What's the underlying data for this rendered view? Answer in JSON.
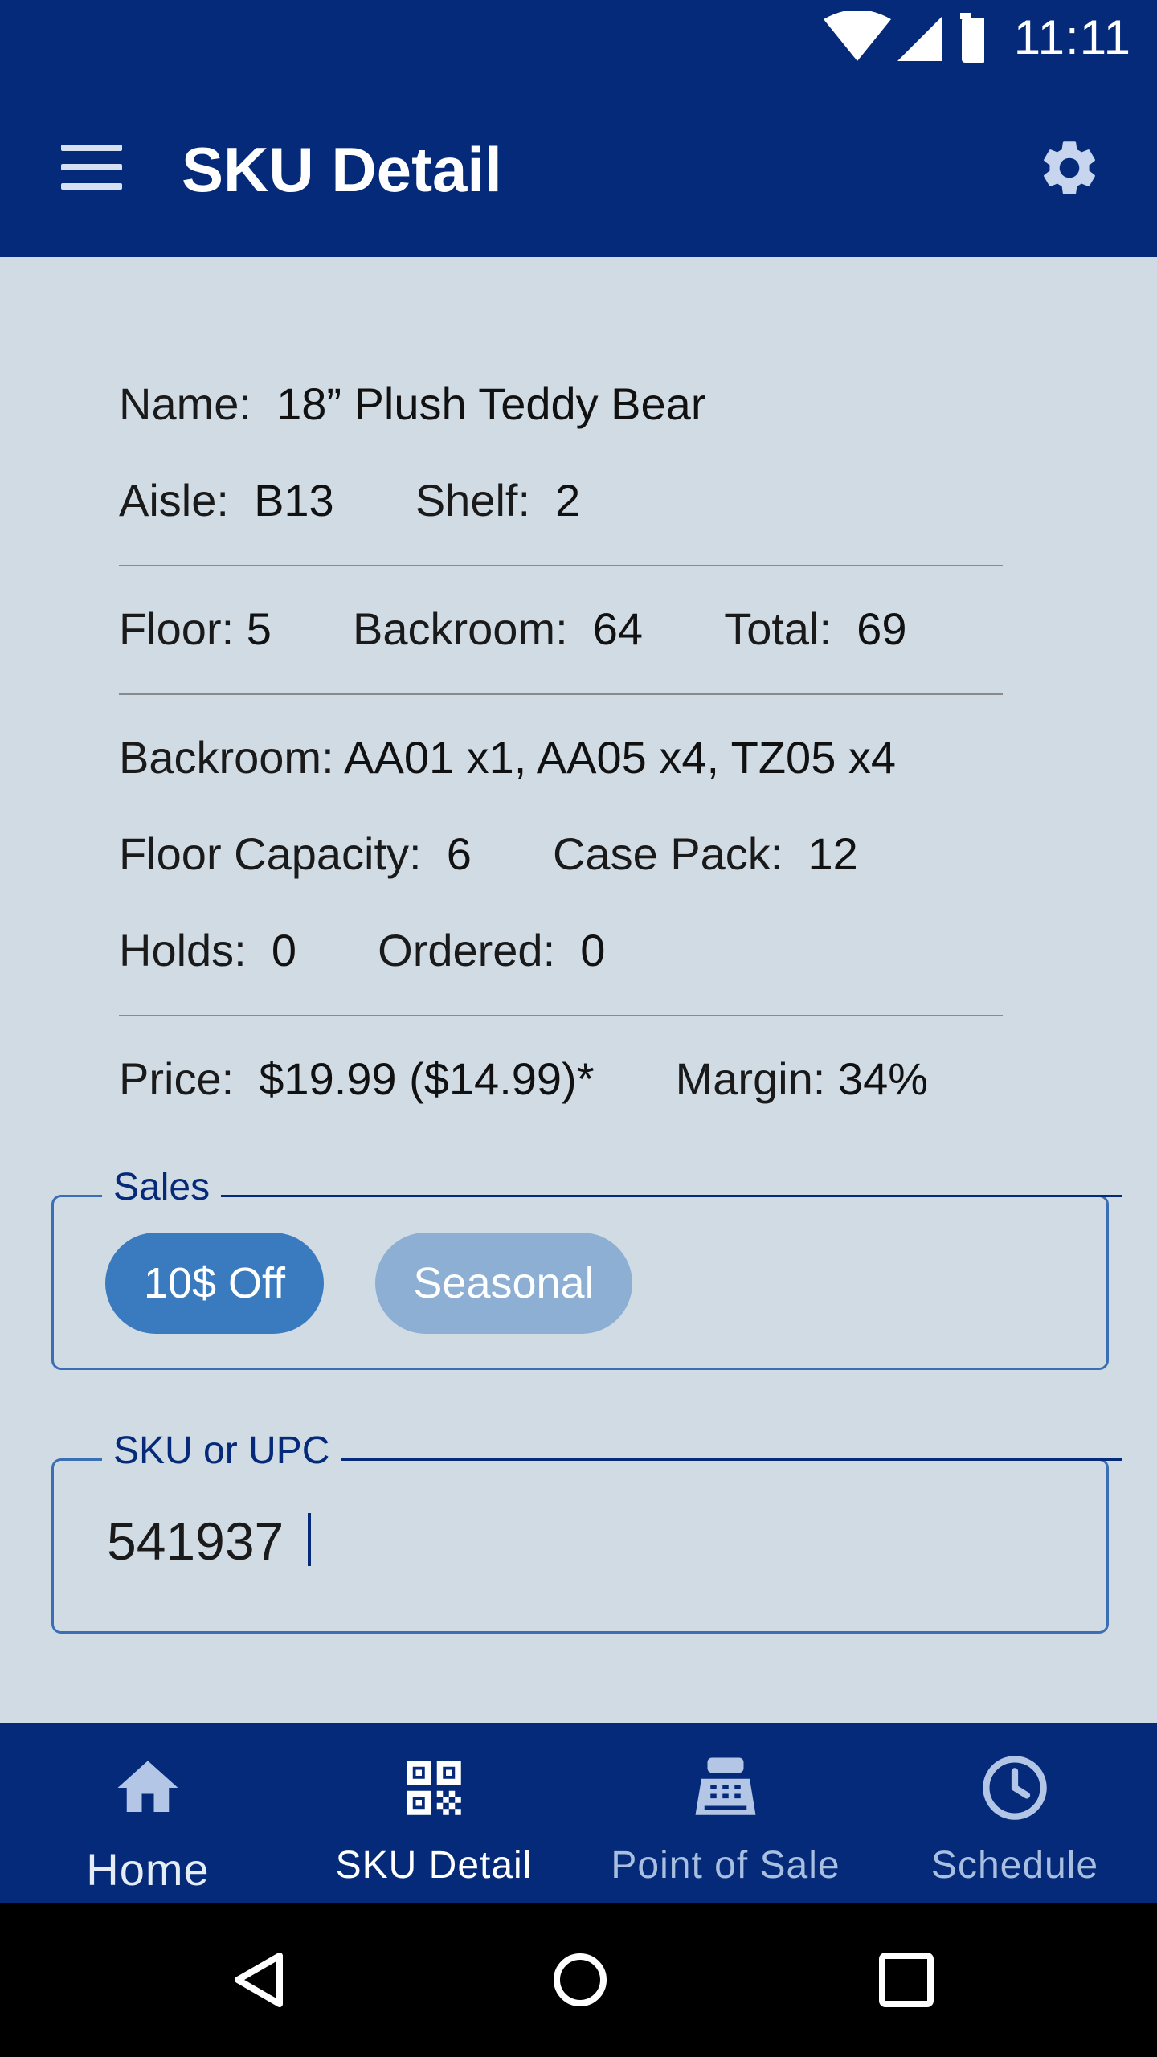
{
  "status_bar": {
    "time": "11:11",
    "icons": [
      "wifi-icon",
      "signal-icon",
      "battery-icon"
    ]
  },
  "app_bar": {
    "title": "SKU Detail",
    "menu_icon": "menu-icon",
    "settings_icon": "gear-icon"
  },
  "item": {
    "name_label": "Name:",
    "name_value": "18” Plush Teddy Bear",
    "aisle_label": "Aisle:",
    "aisle_value": "B13",
    "shelf_label": "Shelf:",
    "shelf_value": "2",
    "floor_label": "Floor:",
    "floor_value": "5",
    "backroom_label": "Backroom:",
    "backroom_value": "64",
    "total_label": "Total:",
    "total_value": "69",
    "backroom_locations_label": "Backroom:",
    "backroom_locations_value": "AA01 x1, AA05 x4, TZ05 x4",
    "floor_capacity_label": "Floor Capacity:",
    "floor_capacity_value": "6",
    "case_pack_label": "Case Pack:",
    "case_pack_value": "12",
    "holds_label": "Holds:",
    "holds_value": "0",
    "ordered_label": "Ordered:",
    "ordered_value": "0",
    "price_label": "Price:",
    "price_value": "$19.99 ($14.99)*",
    "margin_label": "Margin:",
    "margin_value": "34%"
  },
  "sales": {
    "legend": "Sales",
    "chips": [
      {
        "label": "10$ Off",
        "active": true
      },
      {
        "label": "Seasonal",
        "active": false
      }
    ]
  },
  "sku_input": {
    "legend": "SKU or UPC",
    "value": "541937"
  },
  "bottom_nav": {
    "items": [
      {
        "label": "Home",
        "icon": "home-icon"
      },
      {
        "label": "SKU Detail",
        "icon": "qr-code-icon",
        "active": true
      },
      {
        "label": "Point of Sale",
        "icon": "cash-register-icon"
      },
      {
        "label": "Schedule",
        "icon": "clock-icon"
      }
    ]
  },
  "colors": {
    "primary": "#052a7a",
    "background": "#d0dbe4",
    "chip_active": "#3a7abf",
    "chip_inactive": "#8cafd3",
    "outline": "#3a6fb5"
  }
}
